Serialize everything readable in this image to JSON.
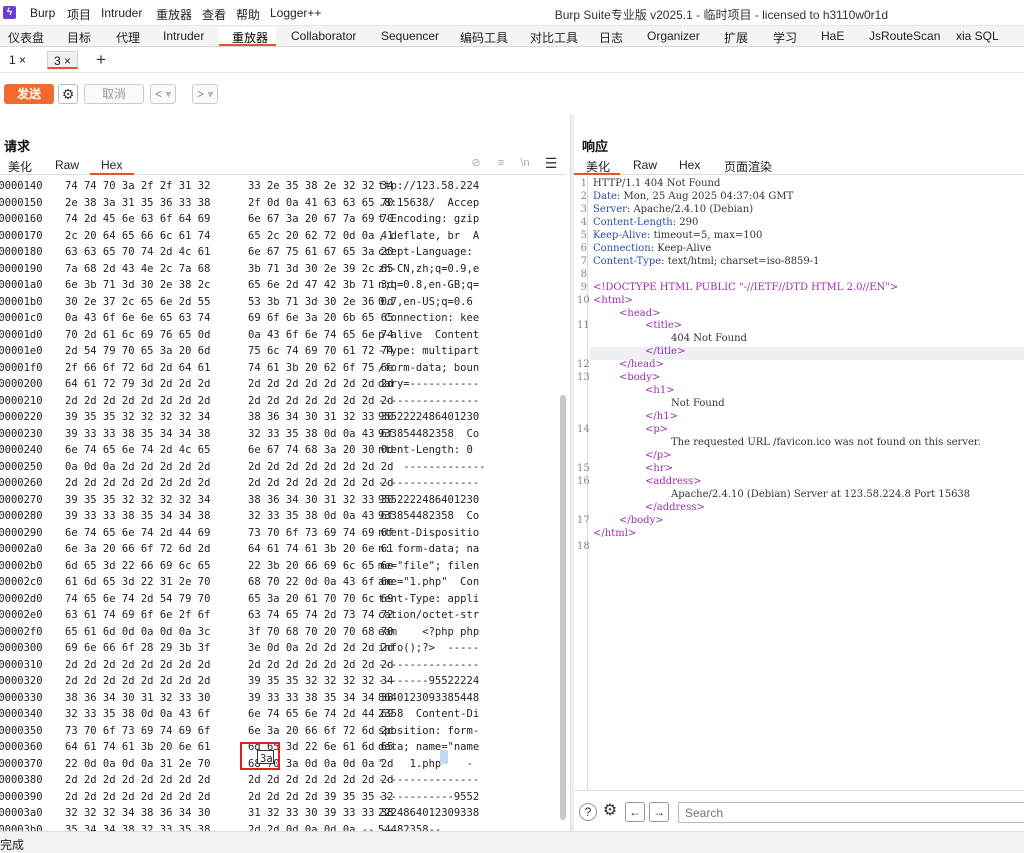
{
  "menu": {
    "items": [
      "Burp",
      "项目",
      "Intruder",
      "重放器",
      "查看",
      "帮助",
      "Logger++"
    ],
    "window_title": "Burp Suite专业版  v2025.1 - 临时项目 - licensed to h3110w0r1d"
  },
  "tool_tabs": [
    "仪表盘",
    "目标",
    "代理",
    "Intruder",
    "重放器",
    "Collaborator",
    "Sequencer",
    "编码工具",
    "对比工具",
    "日志",
    "Organizer",
    "扩展",
    "学习",
    "HaE",
    "JsRouteScan",
    "xia SQL"
  ],
  "repeater_tabs": [
    {
      "label": "1 ×"
    },
    {
      "label": "3 ×"
    }
  ],
  "add_tab_label": "+",
  "toolbar": {
    "send_label": "发送",
    "cancel_label": "取消",
    "back_label": "<",
    "forward_label": ">",
    "dropdown_label": "▾"
  },
  "request": {
    "title": "请求",
    "subtabs": [
      "美化",
      "Raw",
      "Hex"
    ],
    "active_subtab": "Hex",
    "rows": [
      {
        "addr": "00000140",
        "g1": "74 74 70 3a 2f 2f 31 32",
        "g2": "33 2e 35 38 2e 32 32 34",
        "asc": "ttp://123.58.224"
      },
      {
        "addr": "00000150",
        "g1": "2e 38 3a 31 35 36 33 38",
        "g2": "2f 0d 0a 41 63 63 65 70",
        "asc": ".8:15638/  Accep"
      },
      {
        "addr": "00000160",
        "g1": "74 2d 45 6e 63 6f 64 69",
        "g2": "6e 67 3a 20 67 7a 69 70",
        "asc": "t-Encoding: gzip"
      },
      {
        "addr": "00000170",
        "g1": "2c 20 64 65 66 6c 61 74",
        "g2": "65 2c 20 62 72 0d 0a 41",
        "asc": ", deflate, br  A"
      },
      {
        "addr": "00000180",
        "g1": "63 63 65 70 74 2d 4c 61",
        "g2": "6e 67 75 61 67 65 3a 20",
        "asc": "ccept-Language: "
      },
      {
        "addr": "00000190",
        "g1": "7a 68 2d 43 4e 2c 7a 68",
        "g2": "3b 71 3d 30 2e 39 2c 65",
        "asc": "zh-CN,zh;q=0.9,e"
      },
      {
        "addr": "000001a0",
        "g1": "6e 3b 71 3d 30 2e 38 2c",
        "g2": "65 6e 2d 47 42 3b 71 3d",
        "asc": "n;q=0.8,en-GB;q="
      },
      {
        "addr": "000001b0",
        "g1": "30 2e 37 2c 65 6e 2d 55",
        "g2": "53 3b 71 3d 30 2e 36 0d",
        "asc": "0.7,en-US;q=0.6"
      },
      {
        "addr": "000001c0",
        "g1": "0a 43 6f 6e 6e 65 63 74",
        "g2": "69 6f 6e 3a 20 6b 65 65",
        "asc": " Connection: kee"
      },
      {
        "addr": "000001d0",
        "g1": "70 2d 61 6c 69 76 65 0d",
        "g2": "0a 43 6f 6e 74 65 6e 74",
        "asc": "p-alive  Content"
      },
      {
        "addr": "000001e0",
        "g1": "2d 54 79 70 65 3a 20 6d",
        "g2": "75 6c 74 69 70 61 72 74",
        "asc": "-Type: multipart"
      },
      {
        "addr": "000001f0",
        "g1": "2f 66 6f 72 6d 2d 64 61",
        "g2": "74 61 3b 20 62 6f 75 6e",
        "asc": "/form-data; boun"
      },
      {
        "addr": "00000200",
        "g1": "64 61 72 79 3d 2d 2d 2d",
        "g2": "2d 2d 2d 2d 2d 2d 2d 2d",
        "asc": "dary=-----------"
      },
      {
        "addr": "00000210",
        "g1": "2d 2d 2d 2d 2d 2d 2d 2d",
        "g2": "2d 2d 2d 2d 2d 2d 2d 2d",
        "asc": "----------------"
      },
      {
        "addr": "00000220",
        "g1": "39 35 35 32 32 32 32 34",
        "g2": "38 36 34 30 31 32 33 30",
        "asc": "9552222486401230"
      },
      {
        "addr": "00000230",
        "g1": "39 33 33 38 35 34 34 38",
        "g2": "32 33 35 38 0d 0a 43 6f",
        "asc": "933854482358  Co"
      },
      {
        "addr": "00000240",
        "g1": "6e 74 65 6e 74 2d 4c 65",
        "g2": "6e 67 74 68 3a 20 30 0d",
        "asc": "ntent-Length: 0"
      },
      {
        "addr": "00000250",
        "g1": "0a 0d 0a 2d 2d 2d 2d 2d",
        "g2": "2d 2d 2d 2d 2d 2d 2d 2d",
        "asc": "    -------------"
      },
      {
        "addr": "00000260",
        "g1": "2d 2d 2d 2d 2d 2d 2d 2d",
        "g2": "2d 2d 2d 2d 2d 2d 2d 2d",
        "asc": "----------------"
      },
      {
        "addr": "00000270",
        "g1": "39 35 35 32 32 32 32 34",
        "g2": "38 36 34 30 31 32 33 30",
        "asc": "9552222486401230"
      },
      {
        "addr": "00000280",
        "g1": "39 33 33 38 35 34 34 38",
        "g2": "32 33 35 38 0d 0a 43 6f",
        "asc": "933854482358  Co"
      },
      {
        "addr": "00000290",
        "g1": "6e 74 65 6e 74 2d 44 69",
        "g2": "73 70 6f 73 69 74 69 6f",
        "asc": "ntent-Dispositio"
      },
      {
        "addr": "000002a0",
        "g1": "6e 3a 20 66 6f 72 6d 2d",
        "g2": "64 61 74 61 3b 20 6e 61",
        "asc": "n: form-data; na"
      },
      {
        "addr": "000002b0",
        "g1": "6d 65 3d 22 66 69 6c 65",
        "g2": "22 3b 20 66 69 6c 65 6e",
        "asc": "me=\"file\"; filen"
      },
      {
        "addr": "000002c0",
        "g1": "61 6d 65 3d 22 31 2e 70",
        "g2": "68 70 22 0d 0a 43 6f 6e",
        "asc": "ame=\"1.php\"  Con"
      },
      {
        "addr": "000002d0",
        "g1": "74 65 6e 74 2d 54 79 70",
        "g2": "65 3a 20 61 70 70 6c 69",
        "asc": "tent-Type: appli"
      },
      {
        "addr": "000002e0",
        "g1": "63 61 74 69 6f 6e 2f 6f",
        "g2": "63 74 65 74 2d 73 74 72",
        "asc": "cation/octet-str"
      },
      {
        "addr": "000002f0",
        "g1": "65 61 6d 0d 0a 0d 0a 3c",
        "g2": "3f 70 68 70 20 70 68 70",
        "asc": "eam    <?php php"
      },
      {
        "addr": "00000300",
        "g1": "69 6e 66 6f 28 29 3b 3f",
        "g2": "3e 0d 0a 2d 2d 2d 2d 2d",
        "asc": "info();?>  -----"
      },
      {
        "addr": "00000310",
        "g1": "2d 2d 2d 2d 2d 2d 2d 2d",
        "g2": "2d 2d 2d 2d 2d 2d 2d 2d",
        "asc": "----------------"
      },
      {
        "addr": "00000320",
        "g1": "2d 2d 2d 2d 2d 2d 2d 2d",
        "g2": "39 35 35 32 32 32 32 34",
        "asc": "--------95522224"
      },
      {
        "addr": "00000330",
        "g1": "38 36 34 30 31 32 33 30",
        "g2": "39 33 33 38 35 34 34 38",
        "asc": "8640123093385448"
      },
      {
        "addr": "00000340",
        "g1": "32 33 35 38 0d 0a 43 6f",
        "g2": "6e 74 65 6e 74 2d 44 69",
        "asc": "2358  Content-Di"
      },
      {
        "addr": "00000350",
        "g1": "73 70 6f 73 69 74 69 6f",
        "g2": "6e 3a 20 66 6f 72 6d 2d",
        "asc": "sposition: form-"
      },
      {
        "addr": "00000360",
        "g1": "64 61 74 61 3b 20 6e 61",
        "g2": "6d 65 3d 22 6e 61 6d 65",
        "asc": "data; name=\"name"
      },
      {
        "addr": "00000370",
        "g1": "22 0d 0a 0d 0a 31 2e 70",
        "g2": "68 70 3a 0d 0a 0d 0a 2d",
        "asc": "\"    1.php    -"
      },
      {
        "addr": "00000380",
        "g1": "2d 2d 2d 2d 2d 2d 2d 2d",
        "g2": "2d 2d 2d 2d 2d 2d 2d 2d",
        "asc": "----------------"
      },
      {
        "addr": "00000390",
        "g1": "2d 2d 2d 2d 2d 2d 2d 2d",
        "g2": "2d 2d 2d 2d 39 35 35 32",
        "asc": "------------9552"
      },
      {
        "addr": "000003a0",
        "g1": "32 32 32 34 38 36 34 30",
        "g2": "31 32 33 30 39 33 33 38",
        "asc": "2224864012309338"
      },
      {
        "addr": "000003b0",
        "g1": "35 34 34 38 32 33 35 38",
        "g2": "2d 2d 0d 0a 0d 0a -- --",
        "asc": "54482358--"
      }
    ],
    "selected_hex_cell": "3a"
  },
  "response": {
    "title": "响应",
    "subtabs": [
      "美化",
      "Raw",
      "Hex",
      "页面渲染"
    ],
    "active_subtab": "美化",
    "lines": [
      {
        "n": "1",
        "indent": 0,
        "parts": [
          {
            "t": "HTTP/1.1 404 Not Found",
            "c": "plain"
          }
        ]
      },
      {
        "n": "2",
        "indent": 0,
        "parts": [
          {
            "t": "Date",
            "c": "hdr"
          },
          {
            "t": ": Mon, 25 Aug 2025 04:37:04 GMT",
            "c": "plain"
          }
        ]
      },
      {
        "n": "3",
        "indent": 0,
        "parts": [
          {
            "t": "Server",
            "c": "hdr"
          },
          {
            "t": ": Apache/2.4.10 (Debian)",
            "c": "plain"
          }
        ]
      },
      {
        "n": "4",
        "indent": 0,
        "parts": [
          {
            "t": "Content-Length",
            "c": "hdr"
          },
          {
            "t": ": 290",
            "c": "plain"
          }
        ]
      },
      {
        "n": "5",
        "indent": 0,
        "parts": [
          {
            "t": "Keep-Alive",
            "c": "hdr"
          },
          {
            "t": ": timeout=5, max=100",
            "c": "plain"
          }
        ]
      },
      {
        "n": "6",
        "indent": 0,
        "parts": [
          {
            "t": "Connection",
            "c": "hdr"
          },
          {
            "t": ": Keep-Alive",
            "c": "plain"
          }
        ]
      },
      {
        "n": "7",
        "indent": 0,
        "parts": [
          {
            "t": "Content-Type",
            "c": "hdr"
          },
          {
            "t": ": text/html; charset=iso-8859-1",
            "c": "plain"
          }
        ]
      },
      {
        "n": "8",
        "indent": 0,
        "parts": []
      },
      {
        "n": "9",
        "indent": 0,
        "parts": [
          {
            "t": "<!DOCTYPE HTML PUBLIC \"-//IETF//DTD HTML 2.0//EN\">",
            "c": "tag"
          }
        ]
      },
      {
        "n": "10",
        "indent": 0,
        "parts": [
          {
            "t": "<html>",
            "c": "tag"
          }
        ]
      },
      {
        "n": "",
        "indent": 1,
        "parts": [
          {
            "t": "<head>",
            "c": "tag"
          }
        ]
      },
      {
        "n": "11",
        "indent": 2,
        "parts": [
          {
            "t": "<title>",
            "c": "tag"
          }
        ]
      },
      {
        "n": "",
        "indent": 3,
        "parts": [
          {
            "t": "404 Not Found",
            "c": "plain"
          }
        ]
      },
      {
        "n": "",
        "indent": 2,
        "parts": [
          {
            "t": "</title>",
            "c": "tag"
          }
        ]
      },
      {
        "n": "12",
        "indent": 1,
        "parts": [
          {
            "t": "</head>",
            "c": "tag"
          }
        ]
      },
      {
        "n": "13",
        "indent": 1,
        "parts": [
          {
            "t": "<body>",
            "c": "tag"
          }
        ]
      },
      {
        "n": "",
        "indent": 2,
        "parts": [
          {
            "t": "<h1>",
            "c": "tag"
          }
        ]
      },
      {
        "n": "",
        "indent": 3,
        "parts": [
          {
            "t": "Not Found",
            "c": "plain"
          }
        ]
      },
      {
        "n": "",
        "indent": 2,
        "parts": [
          {
            "t": "</h1>",
            "c": "tag"
          }
        ]
      },
      {
        "n": "14",
        "indent": 2,
        "parts": [
          {
            "t": "<p>",
            "c": "tag"
          }
        ]
      },
      {
        "n": "",
        "indent": 3,
        "parts": [
          {
            "t": "The requested URL /favicon.ico was not found on this server.",
            "c": "plain"
          }
        ]
      },
      {
        "n": "",
        "indent": 2,
        "parts": [
          {
            "t": "</p>",
            "c": "tag"
          }
        ]
      },
      {
        "n": "15",
        "indent": 2,
        "parts": [
          {
            "t": "<hr>",
            "c": "tag"
          }
        ]
      },
      {
        "n": "16",
        "indent": 2,
        "parts": [
          {
            "t": "<address>",
            "c": "tag"
          }
        ]
      },
      {
        "n": "",
        "indent": 3,
        "parts": [
          {
            "t": "Apache/2.4.10 (Debian) Server at 123.58.224.8 Port 15638",
            "c": "plain"
          }
        ]
      },
      {
        "n": "",
        "indent": 2,
        "parts": [
          {
            "t": "</address>",
            "c": "tag"
          }
        ]
      },
      {
        "n": "17",
        "indent": 1,
        "parts": [
          {
            "t": "</body>",
            "c": "tag"
          }
        ]
      },
      {
        "n": "",
        "indent": 0,
        "parts": [
          {
            "t": "</html>",
            "c": "tag"
          }
        ]
      },
      {
        "n": "18",
        "indent": 0,
        "parts": []
      }
    ],
    "search_placeholder": "Search"
  },
  "status": {
    "text": "完成"
  },
  "colors": {
    "accent": "#e8542a",
    "send": "#f26a2e",
    "tag": "#9b2fae",
    "header": "#2b4ea3",
    "highlight_box": "#e02020"
  }
}
